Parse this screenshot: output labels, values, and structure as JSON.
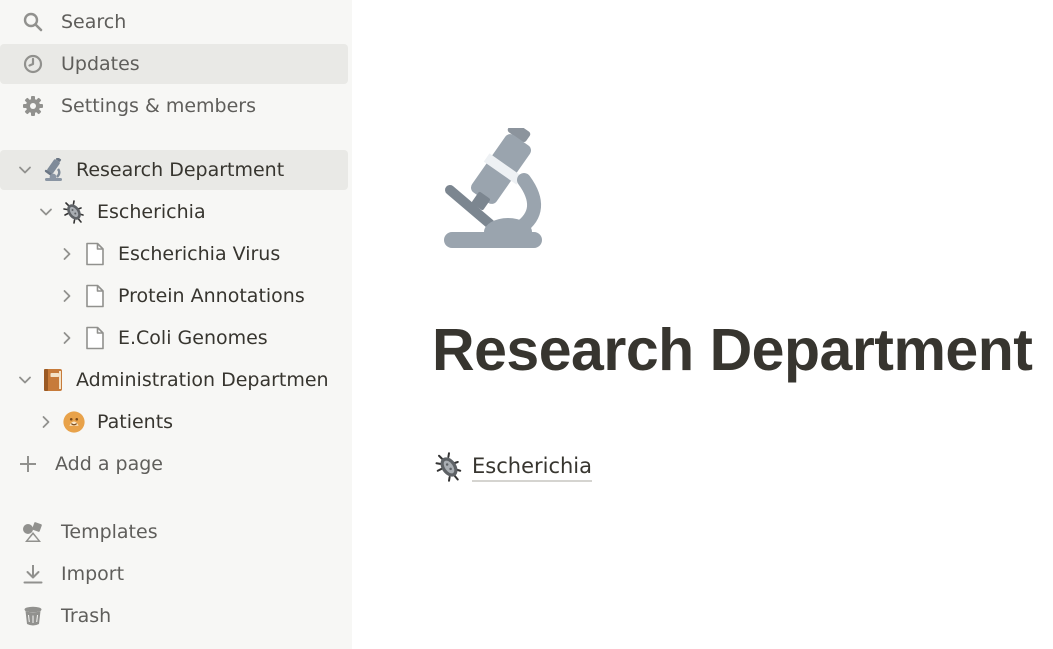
{
  "sidebar": {
    "top_items": [
      {
        "label": "Search",
        "icon": "search-icon"
      },
      {
        "label": "Updates",
        "icon": "clock-icon"
      },
      {
        "label": "Settings & members",
        "icon": "gear-icon"
      }
    ],
    "tree": {
      "research": {
        "label": "Research Department",
        "icon": "microscope-icon"
      },
      "escherichia": {
        "label": "Escherichia",
        "icon": "bacteria-icon"
      },
      "escherichia_virus": {
        "label": "Escherichia Virus",
        "icon": "page-icon"
      },
      "protein_annotations": {
        "label": "Protein Annotations",
        "icon": "page-icon"
      },
      "ecoli_genomes": {
        "label": "E.Coli Genomes",
        "icon": "page-icon"
      },
      "administration": {
        "label": "Administration Departmen",
        "icon": "notebook-icon"
      },
      "patients": {
        "label": "Patients",
        "icon": "face-icon"
      }
    },
    "add_page_label": "Add a page",
    "bottom_items": [
      {
        "label": "Templates",
        "icon": "shapes-icon"
      },
      {
        "label": "Import",
        "icon": "download-icon"
      },
      {
        "label": "Trash",
        "icon": "trash-icon"
      }
    ]
  },
  "main": {
    "title": "Research Department",
    "subpage_label": "Escherichia"
  }
}
